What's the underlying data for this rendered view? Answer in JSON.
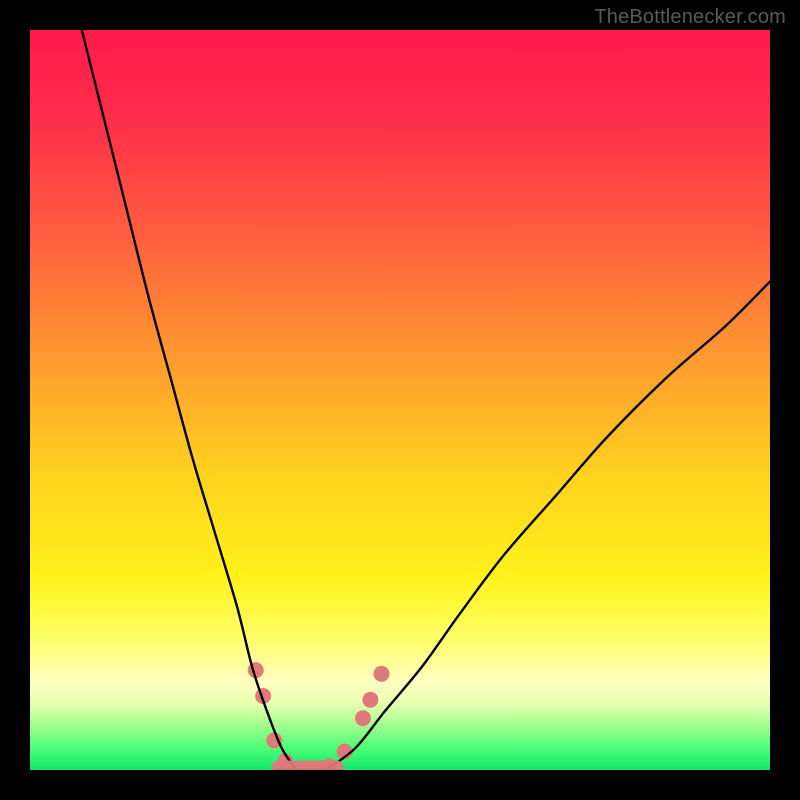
{
  "watermark": "TheBottlenecker.com",
  "gradient": {
    "stops": [
      {
        "offset": 0.0,
        "color": "#ff1a4c"
      },
      {
        "offset": 0.12,
        "color": "#ff2d4a"
      },
      {
        "offset": 0.28,
        "color": "#ff5f3e"
      },
      {
        "offset": 0.45,
        "color": "#ff9c2f"
      },
      {
        "offset": 0.6,
        "color": "#ffd21f"
      },
      {
        "offset": 0.74,
        "color": "#fff21a"
      },
      {
        "offset": 0.82,
        "color": "#ffff66"
      },
      {
        "offset": 0.88,
        "color": "#ffffc0"
      },
      {
        "offset": 0.91,
        "color": "#e8ffb0"
      },
      {
        "offset": 0.94,
        "color": "#a0ff8c"
      },
      {
        "offset": 0.97,
        "color": "#4dff79"
      },
      {
        "offset": 1.0,
        "color": "#14e76a"
      }
    ]
  },
  "chart_data": {
    "type": "line",
    "title": "",
    "xlabel": "",
    "ylabel": "",
    "xlim": [
      0,
      100
    ],
    "ylim": [
      0,
      100
    ],
    "curve1_note": "Left arm descending from top-left to the minimum",
    "curve2_note": "Right arm ascending from the minimum toward mid-right",
    "series": [
      {
        "name": "left-arm",
        "x": [
          7,
          10,
          13,
          16,
          19,
          22,
          25,
          28,
          30,
          32,
          34,
          36
        ],
        "y": [
          100,
          88,
          76,
          64,
          53,
          42,
          32,
          22,
          14,
          8,
          3,
          0
        ]
      },
      {
        "name": "right-arm",
        "x": [
          40,
          44,
          48,
          53,
          58,
          64,
          71,
          78,
          86,
          94,
          100
        ],
        "y": [
          0,
          3,
          8,
          14,
          21,
          29,
          37,
          45,
          53,
          60,
          66
        ]
      }
    ],
    "minimum_plateau": {
      "x_range": [
        33,
        42
      ],
      "y": 0
    },
    "markers": {
      "color": "#e07a7a",
      "radius_px": 8,
      "points": [
        {
          "x": 30.5,
          "y": 13.5
        },
        {
          "x": 31.5,
          "y": 10.0
        },
        {
          "x": 33.0,
          "y": 4.0
        },
        {
          "x": 34.5,
          "y": 1.2
        },
        {
          "x": 36.5,
          "y": 0.0
        },
        {
          "x": 38.5,
          "y": 0.0
        },
        {
          "x": 40.5,
          "y": 0.5
        },
        {
          "x": 42.5,
          "y": 2.5
        },
        {
          "x": 45.0,
          "y": 7.0
        },
        {
          "x": 46.0,
          "y": 9.5
        },
        {
          "x": 47.5,
          "y": 13.0
        }
      ]
    }
  }
}
